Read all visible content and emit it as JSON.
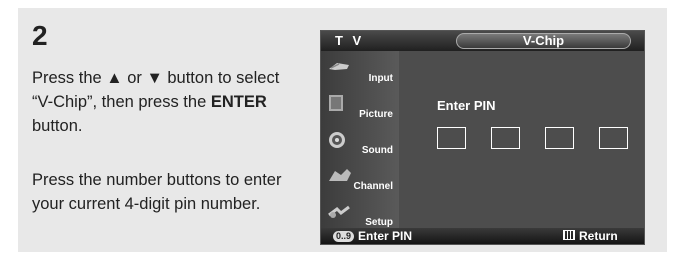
{
  "step_number": "2",
  "instruction1": {
    "part1": "Press the ▲ or ▼ button to select “V-Chip”, then press the ",
    "bold": "ENTER",
    "part2": " button."
  },
  "instruction2": "Press the number buttons to enter your current 4-digit pin number.",
  "osd": {
    "tv_label": "T V",
    "title": "V-Chip",
    "menu": [
      {
        "label": "Input",
        "icon": "input-icon"
      },
      {
        "label": "Picture",
        "icon": "picture-icon"
      },
      {
        "label": "Sound",
        "icon": "sound-icon"
      },
      {
        "label": "Channel",
        "icon": "channel-icon"
      },
      {
        "label": "Setup",
        "icon": "setup-icon"
      }
    ],
    "pin_label": "Enter PIN",
    "pin_digits": [
      "",
      "",
      "",
      ""
    ],
    "footer_left_icon": "0..9",
    "footer_left": "Enter PIN",
    "footer_right": "Return"
  },
  "colors": {
    "panel_bg": "#e8e8e8",
    "osd_bg": "#4d4d4d"
  }
}
